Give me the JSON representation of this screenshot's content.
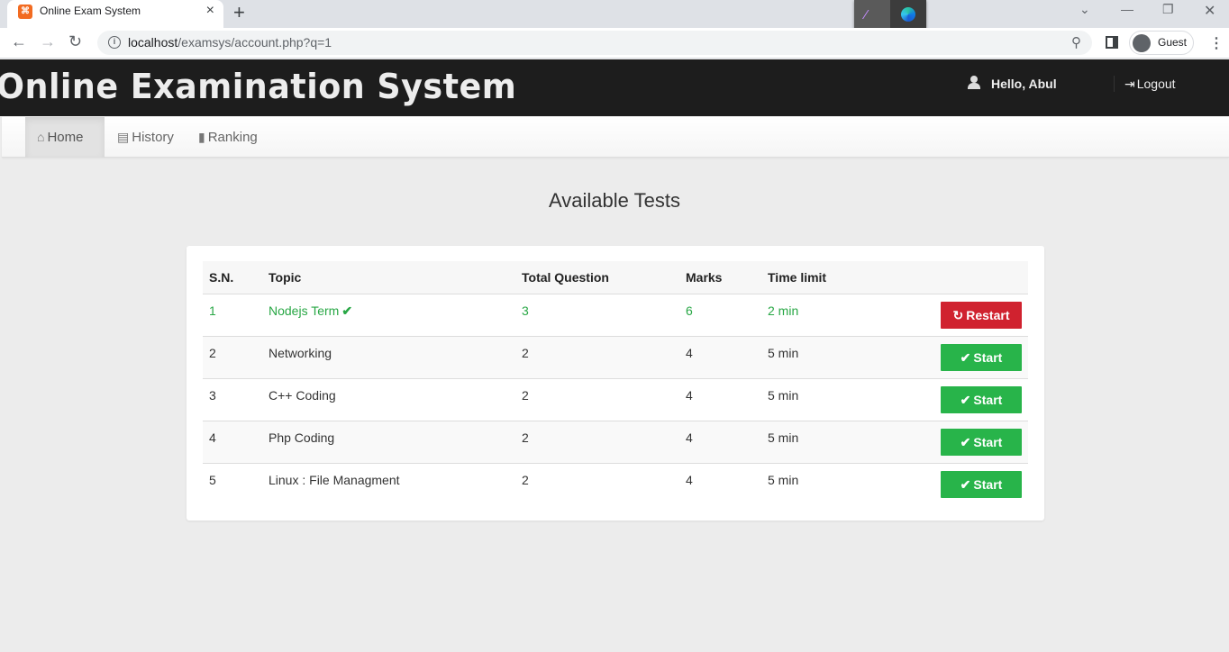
{
  "browser": {
    "tab_title": "Online Exam System",
    "tab_favicon": "xampp-icon",
    "url_host": "localhost",
    "url_path": "/examsys/account.php?q=1",
    "profile_label": "Guest"
  },
  "header": {
    "brand": "Online Examination System",
    "greeting": "Hello,  Abul",
    "logout_label": "Logout"
  },
  "nav": {
    "home": "Home",
    "history": "History",
    "ranking": "Ranking"
  },
  "main": {
    "title": "Available Tests",
    "columns": {
      "sn": "S.N.",
      "topic": "Topic",
      "total_question": "Total Question",
      "marks": "Marks",
      "time_limit": "Time limit"
    },
    "rows": [
      {
        "sn": "1",
        "topic": "Nodejs Term",
        "total_question": "3",
        "marks": "6",
        "time": "2 min",
        "action": "Restart"
      },
      {
        "sn": "2",
        "topic": "Networking",
        "total_question": "2",
        "marks": "4",
        "time": "5 min",
        "action": "Start"
      },
      {
        "sn": "3",
        "topic": "C++ Coding",
        "total_question": "2",
        "marks": "4",
        "time": "5 min",
        "action": "Start"
      },
      {
        "sn": "4",
        "topic": "Php Coding",
        "total_question": "2",
        "marks": "4",
        "time": "5 min",
        "action": "Start"
      },
      {
        "sn": "5",
        "topic": "Linux : File Managment",
        "total_question": "2",
        "marks": "4",
        "time": "5 min",
        "action": "Start"
      }
    ]
  },
  "colors": {
    "header_bg": "#1d1d1d",
    "completed_text": "#28a745",
    "restart_button": "#d0222f",
    "start_button": "#28b44a",
    "page_bg": "#ececec"
  }
}
